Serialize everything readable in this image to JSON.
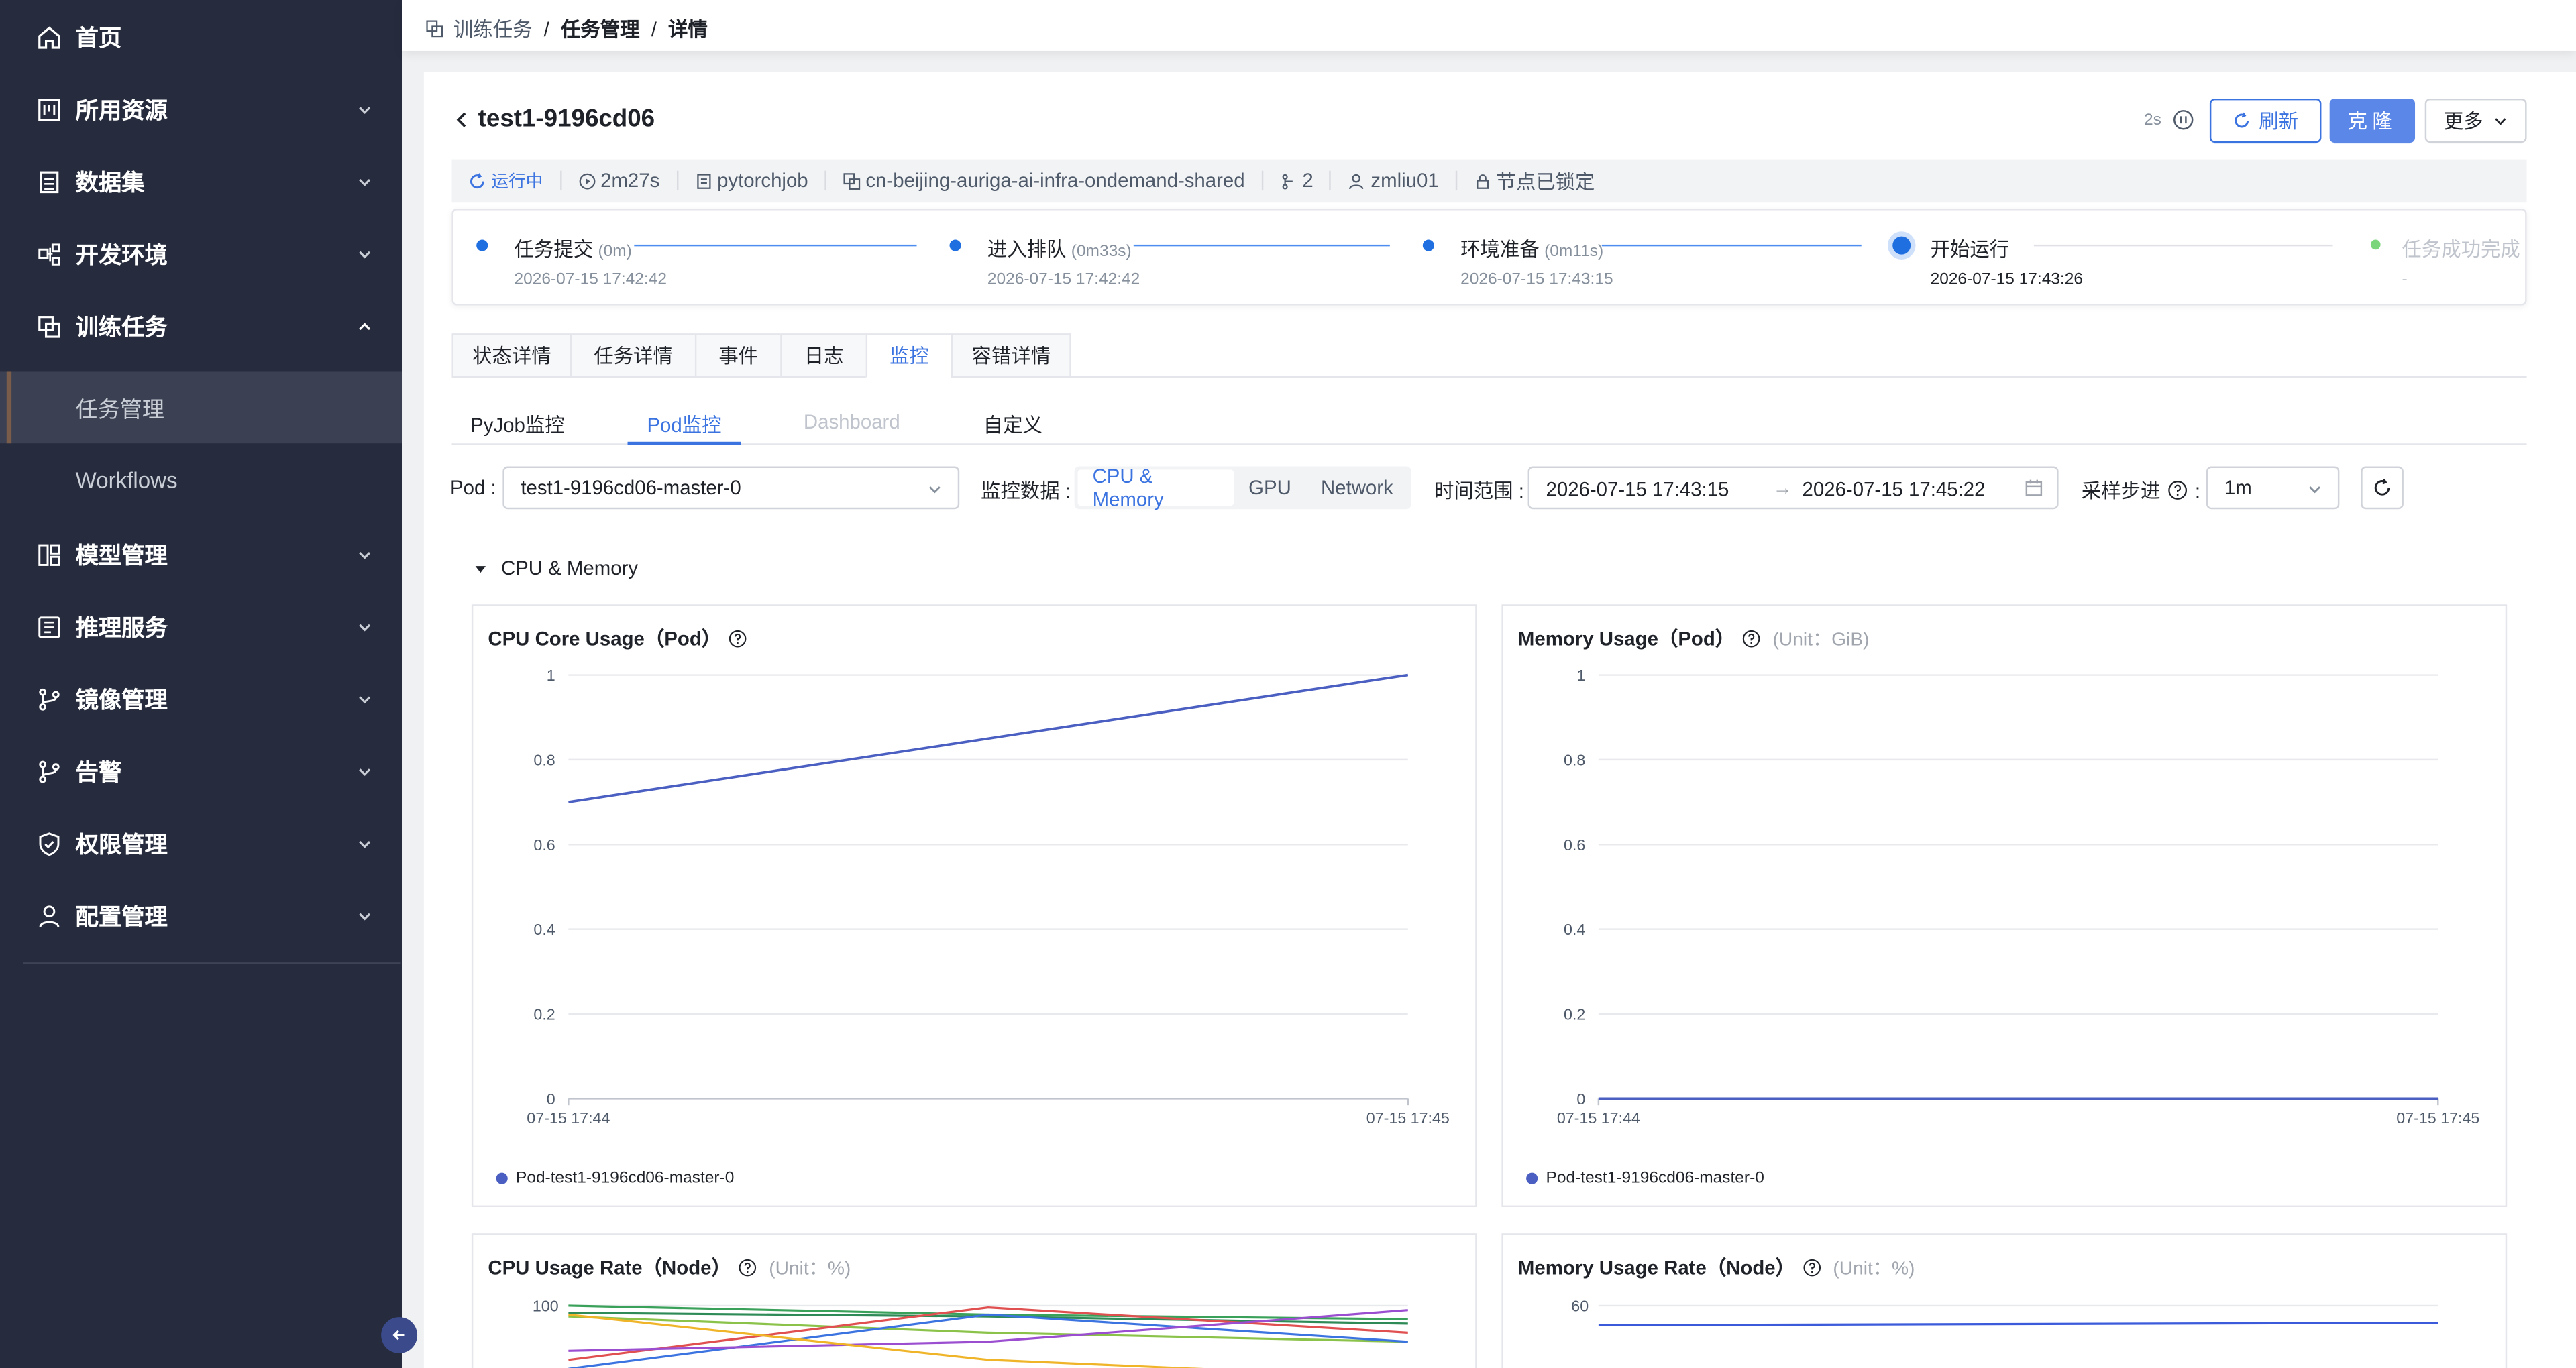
{
  "sidebar": {
    "items": [
      {
        "label": "首页",
        "icon": "home-icon"
      },
      {
        "label": "所用资源",
        "icon": "resource-icon"
      },
      {
        "label": "数据集",
        "icon": "dataset-icon"
      },
      {
        "label": "开发环境",
        "icon": "dev-env-icon"
      },
      {
        "label": "训练任务",
        "icon": "training-icon"
      },
      {
        "label": "模型管理",
        "icon": "model-icon"
      },
      {
        "label": "推理服务",
        "icon": "inference-icon"
      },
      {
        "label": "镜像管理",
        "icon": "image-branch-icon"
      },
      {
        "label": "告警",
        "icon": "alert-branch-icon"
      },
      {
        "label": "权限管理",
        "icon": "shield-icon"
      },
      {
        "label": "配置管理",
        "icon": "user-icon"
      }
    ],
    "sub_items": [
      {
        "label": "任务管理",
        "active": true
      },
      {
        "label": "Workflows",
        "active": false
      }
    ]
  },
  "breadcrumb": {
    "items": [
      "训练任务",
      "任务管理",
      "详情"
    ]
  },
  "header": {
    "title": "test1-9196cd06",
    "timer": "2s",
    "refresh_label": "刷新",
    "clone_label": "克隆",
    "more_label": "更多"
  },
  "info": {
    "status": "运行中",
    "duration": "2m27s",
    "type": "pytorchjob",
    "cluster": "cn-beijing-auriga-ai-infra-ondemand-shared",
    "replicas": "2",
    "user": "zmliu01",
    "lock": "节点已锁定"
  },
  "steps": [
    {
      "name": "任务提交",
      "duration": "(0m)",
      "time": "2026-07-15 17:42:42",
      "state": "done"
    },
    {
      "name": "进入排队",
      "duration": "(0m33s)",
      "time": "2026-07-15 17:42:42",
      "state": "done"
    },
    {
      "name": "环境准备",
      "duration": "(0m11s)",
      "time": "2026-07-15 17:43:15",
      "state": "done"
    },
    {
      "name": "开始运行",
      "duration": "",
      "time": "2026-07-15 17:43:26",
      "state": "current"
    },
    {
      "name": "任务成功完成",
      "duration": "",
      "time": "-",
      "state": "pending"
    }
  ],
  "tabs": [
    "状态详情",
    "任务详情",
    "事件",
    "日志",
    "监控",
    "容错详情"
  ],
  "active_tab": "监控",
  "subtabs": [
    "PyJob监控",
    "Pod监控",
    "Dashboard",
    "自定义"
  ],
  "active_subtab": "Pod监控",
  "filters": {
    "pod_label": "Pod :",
    "pod_value": "test1-9196cd06-master-0",
    "metrics_label": "监控数据 :",
    "metrics_options": [
      "CPU & Memory",
      "GPU",
      "Network"
    ],
    "metrics_active": "CPU & Memory",
    "range_label": "时间范围 :",
    "range_from": "2026-07-15 17:43:15",
    "range_to": "2026-07-15 17:45:22",
    "step_label": "采样步进",
    "step_value": "1m"
  },
  "section": {
    "title": "CPU & Memory"
  },
  "colors": {
    "sidebar_bg": "#262c3d",
    "accent": "#3b73e0",
    "series": "#4a5fc1"
  },
  "chart_data": [
    {
      "type": "line",
      "title": "CPU Core Usage（Pod）",
      "unit": "",
      "x": [
        "07-15 17:44",
        "07-15 17:45"
      ],
      "ylim": [
        0,
        1
      ],
      "yticks": [
        "1",
        "0.8",
        "0.6",
        "0.4",
        "0.2",
        "0"
      ],
      "series": [
        {
          "name": "Pod-test1-9196cd06-master-0",
          "values": [
            0.7,
            1.0
          ],
          "color": "#4a5fc1"
        }
      ],
      "legend": "bottom-left"
    },
    {
      "type": "line",
      "title": "Memory Usage（Pod）",
      "unit": "(Unit：GiB)",
      "x": [
        "07-15 17:44",
        "07-15 17:45"
      ],
      "ylim": [
        0,
        1
      ],
      "yticks": [
        "1",
        "0.8",
        "0.6",
        "0.4",
        "0.2",
        "0"
      ],
      "series": [
        {
          "name": "Pod-test1-9196cd06-master-0",
          "values": [
            0.0,
            0.0
          ],
          "color": "#4a5fc1"
        }
      ],
      "legend": "bottom-left"
    },
    {
      "type": "line",
      "title": "CPU Usage Rate（Node）",
      "unit": "(Unit：%)",
      "yticks": [
        "100"
      ],
      "series": [
        {
          "color": "#3aa15a",
          "values": [
            100,
            90,
            85
          ]
        },
        {
          "color": "#2e8b57",
          "values": [
            92,
            88,
            80
          ]
        },
        {
          "color": "#8bc34a",
          "values": [
            88,
            70,
            60
          ]
        },
        {
          "color": "#e05050",
          "values": [
            40,
            98,
            70
          ]
        },
        {
          "color": "#3b73e0",
          "values": [
            30,
            90,
            60
          ]
        },
        {
          "color": "#9b4fd0",
          "values": [
            50,
            60,
            95
          ]
        },
        {
          "color": "#f0b429",
          "values": [
            90,
            40,
            20
          ]
        }
      ]
    },
    {
      "type": "line",
      "title": "Memory Usage Rate（Node）",
      "unit": "(Unit：%)",
      "yticks": [
        "60"
      ],
      "series": [
        {
          "color": "#3b5bdb",
          "values": [
            52,
            53
          ]
        }
      ]
    }
  ]
}
